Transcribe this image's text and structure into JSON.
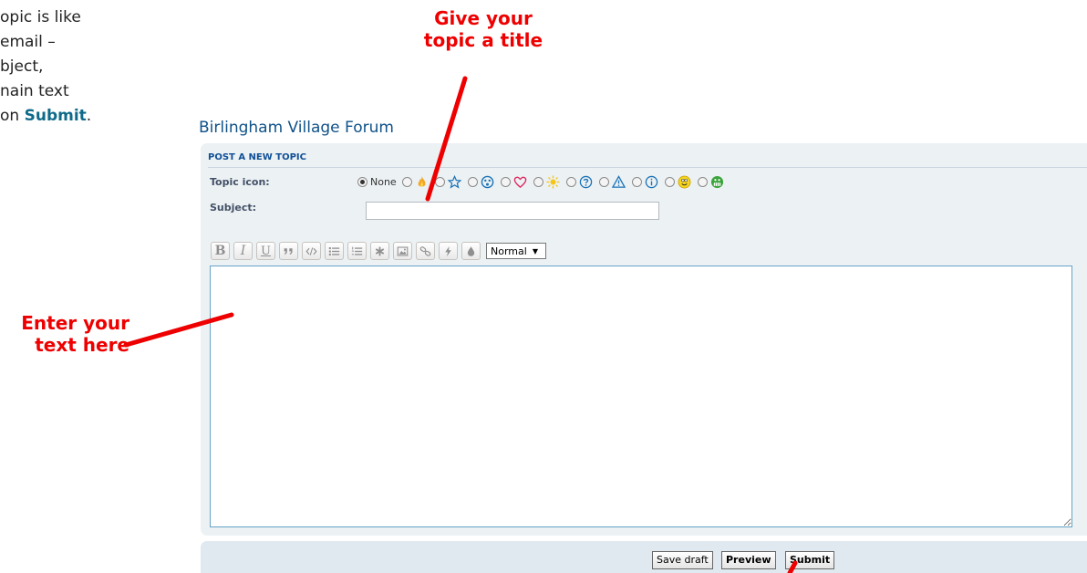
{
  "intro": {
    "line1": "opic is like",
    "line2": "email –",
    "line3": "bject,",
    "line4": "nain text",
    "line5_before": "on ",
    "line5_highlight": "Submit",
    "line5_after": "."
  },
  "callouts": {
    "title_line1": "Give your",
    "title_line2": "topic a title",
    "text_line1": "Enter your",
    "text_line2": "text here"
  },
  "forum": {
    "name": "Birlingham Village Forum",
    "panel_header": "POST A NEW TOPIC",
    "topic_icon_label": "Topic icon:",
    "topic_icon_none": "None",
    "topic_icons": [
      "fire-icon",
      "star-icon",
      "surprised-face-icon",
      "heart-icon",
      "sun-icon",
      "question-icon",
      "warning-icon",
      "info-icon",
      "smiley-icon",
      "grinning-face-icon"
    ],
    "selected_topic_icon": "None",
    "subject_label": "Subject:",
    "subject_value": "",
    "toolbar": {
      "bold": "B",
      "italic": "I",
      "underline": "U",
      "font_size_selected": "Normal"
    },
    "message_value": ""
  },
  "actions": {
    "save_draft": "Save draft",
    "preview": "Preview",
    "submit": "Submit"
  },
  "colors": {
    "annotation": "#ee0000",
    "highlight": "#0f6a8a",
    "forum_title": "#105289",
    "panel_bg": "#ecf1f3"
  }
}
